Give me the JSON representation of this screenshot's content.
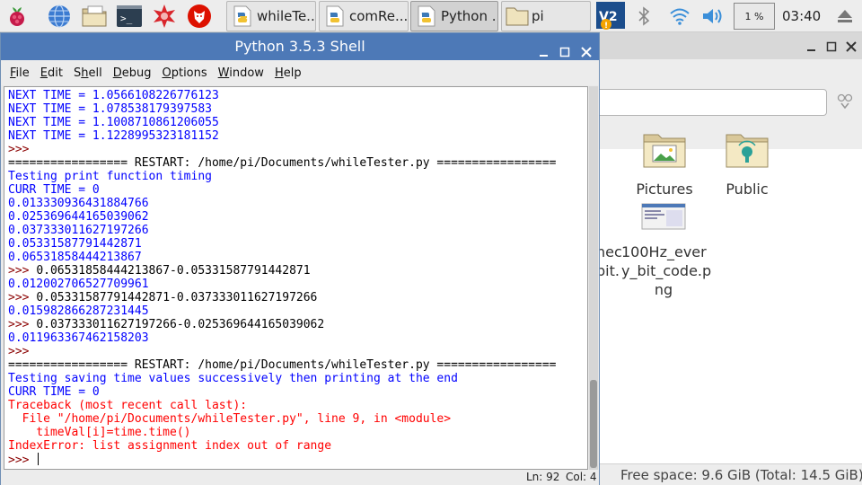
{
  "taskbar": {
    "launchers": [
      "raspberry-menu-icon",
      "web-browser-icon",
      "file-manager-icon",
      "terminal-icon",
      "mathematica-icon",
      "wolfram-icon"
    ],
    "windows": [
      {
        "label": "whileTe...",
        "icon": "python-file-icon",
        "active": false
      },
      {
        "label": "comRe...",
        "icon": "python-file-icon",
        "active": false
      },
      {
        "label": "Python ...",
        "icon": "python-file-icon",
        "active": true
      },
      {
        "label": "pi",
        "icon": "folder-icon",
        "active": false
      }
    ],
    "cpu": "1 %",
    "clock": "03:40"
  },
  "shell": {
    "title": "Python 3.5.3 Shell",
    "menus": [
      {
        "label": "File",
        "key": "F"
      },
      {
        "label": "Edit",
        "key": "E"
      },
      {
        "label": "Shell",
        "key": "h"
      },
      {
        "label": "Debug",
        "key": "D"
      },
      {
        "label": "Options",
        "key": "O"
      },
      {
        "label": "Window",
        "key": "W"
      },
      {
        "label": "Help",
        "key": "H"
      }
    ],
    "lines": [
      {
        "text": "NEXT TIME = 1.0566108226776123",
        "color": "blue"
      },
      {
        "text": "NEXT TIME = 1.078538179397583",
        "color": "blue"
      },
      {
        "text": "NEXT TIME = 1.1008710861206055",
        "color": "blue"
      },
      {
        "text": "NEXT TIME = 1.1228995323181152",
        "color": "blue"
      },
      {
        "text": ">>> ",
        "color": "maroon"
      },
      {
        "text": "================= RESTART: /home/pi/Documents/whileTester.py =================",
        "color": "black"
      },
      {
        "text": "Testing print function timing",
        "color": "blue"
      },
      {
        "text": "CURR TIME = 0",
        "color": "blue"
      },
      {
        "text": "0.013330936431884766",
        "color": "blue"
      },
      {
        "text": "0.025369644165039062",
        "color": "blue"
      },
      {
        "text": "0.037333011627197266",
        "color": "blue"
      },
      {
        "text": "0.05331587791442871",
        "color": "blue"
      },
      {
        "text": "0.06531858444213867",
        "color": "blue"
      },
      {
        "text": ">>> ",
        "color": "maroon",
        "input": "0.06531858444213867-0.05331587791442871"
      },
      {
        "text": "0.012002706527709961",
        "color": "blue"
      },
      {
        "text": ">>> ",
        "color": "maroon",
        "input": "0.05331587791442871-0.037333011627197266"
      },
      {
        "text": "0.015982866287231445",
        "color": "blue"
      },
      {
        "text": ">>> ",
        "color": "maroon",
        "input": "0.037333011627197266-0.025369644165039062"
      },
      {
        "text": "0.011963367462158203",
        "color": "blue"
      },
      {
        "text": ">>> ",
        "color": "maroon"
      },
      {
        "text": "================= RESTART: /home/pi/Documents/whileTester.py =================",
        "color": "black"
      },
      {
        "text": "Testing saving time values successively then printing at the end",
        "color": "blue"
      },
      {
        "text": "CURR TIME = 0",
        "color": "blue"
      },
      {
        "text": "Traceback (most recent call last):",
        "color": "red"
      },
      {
        "text": "  File \"/home/pi/Documents/whileTester.py\", line 9, in <module>",
        "color": "red"
      },
      {
        "text": "    timeVal[i]=time.time()",
        "color": "red"
      },
      {
        "text": "IndexError: list assignment index out of range",
        "color": "red"
      },
      {
        "text": ">>> ",
        "color": "maroon",
        "cursor": true
      }
    ],
    "status": {
      "line": "Ln: 92",
      "col": "Col: 4"
    }
  },
  "file_manager": {
    "items": [
      {
        "label": "Pictures",
        "icon": "pictures-folder-icon"
      },
      {
        "label": "Public",
        "icon": "public-folder-icon"
      },
      {
        "label": "nec\nbit.",
        "icon": "none"
      },
      {
        "label": "100Hz_ever\ny_bit_code.p\nng",
        "icon": "image-thumbnail-icon"
      }
    ],
    "status": "Free space: 9.6 GiB (Total: 14.5 GiB)"
  }
}
